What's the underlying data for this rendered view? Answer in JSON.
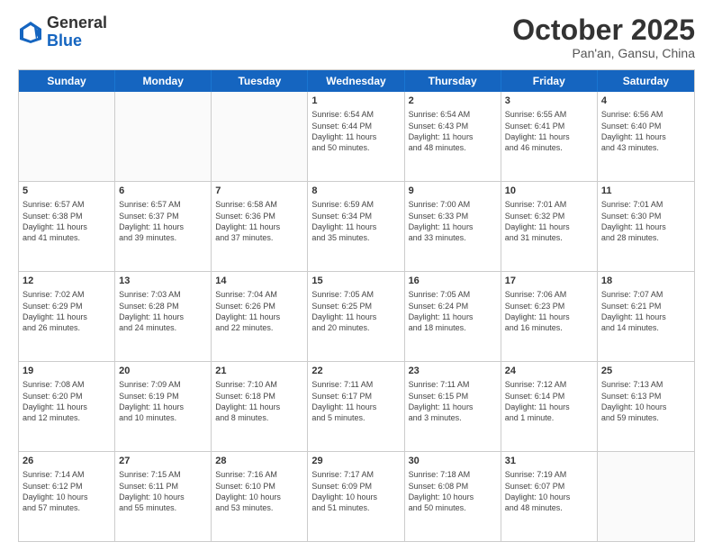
{
  "logo": {
    "general": "General",
    "blue": "Blue"
  },
  "title": "October 2025",
  "subtitle": "Pan'an, Gansu, China",
  "headers": [
    "Sunday",
    "Monday",
    "Tuesday",
    "Wednesday",
    "Thursday",
    "Friday",
    "Saturday"
  ],
  "weeks": [
    [
      {
        "day": "",
        "info": ""
      },
      {
        "day": "",
        "info": ""
      },
      {
        "day": "",
        "info": ""
      },
      {
        "day": "1",
        "info": "Sunrise: 6:54 AM\nSunset: 6:44 PM\nDaylight: 11 hours\nand 50 minutes."
      },
      {
        "day": "2",
        "info": "Sunrise: 6:54 AM\nSunset: 6:43 PM\nDaylight: 11 hours\nand 48 minutes."
      },
      {
        "day": "3",
        "info": "Sunrise: 6:55 AM\nSunset: 6:41 PM\nDaylight: 11 hours\nand 46 minutes."
      },
      {
        "day": "4",
        "info": "Sunrise: 6:56 AM\nSunset: 6:40 PM\nDaylight: 11 hours\nand 43 minutes."
      }
    ],
    [
      {
        "day": "5",
        "info": "Sunrise: 6:57 AM\nSunset: 6:38 PM\nDaylight: 11 hours\nand 41 minutes."
      },
      {
        "day": "6",
        "info": "Sunrise: 6:57 AM\nSunset: 6:37 PM\nDaylight: 11 hours\nand 39 minutes."
      },
      {
        "day": "7",
        "info": "Sunrise: 6:58 AM\nSunset: 6:36 PM\nDaylight: 11 hours\nand 37 minutes."
      },
      {
        "day": "8",
        "info": "Sunrise: 6:59 AM\nSunset: 6:34 PM\nDaylight: 11 hours\nand 35 minutes."
      },
      {
        "day": "9",
        "info": "Sunrise: 7:00 AM\nSunset: 6:33 PM\nDaylight: 11 hours\nand 33 minutes."
      },
      {
        "day": "10",
        "info": "Sunrise: 7:01 AM\nSunset: 6:32 PM\nDaylight: 11 hours\nand 31 minutes."
      },
      {
        "day": "11",
        "info": "Sunrise: 7:01 AM\nSunset: 6:30 PM\nDaylight: 11 hours\nand 28 minutes."
      }
    ],
    [
      {
        "day": "12",
        "info": "Sunrise: 7:02 AM\nSunset: 6:29 PM\nDaylight: 11 hours\nand 26 minutes."
      },
      {
        "day": "13",
        "info": "Sunrise: 7:03 AM\nSunset: 6:28 PM\nDaylight: 11 hours\nand 24 minutes."
      },
      {
        "day": "14",
        "info": "Sunrise: 7:04 AM\nSunset: 6:26 PM\nDaylight: 11 hours\nand 22 minutes."
      },
      {
        "day": "15",
        "info": "Sunrise: 7:05 AM\nSunset: 6:25 PM\nDaylight: 11 hours\nand 20 minutes."
      },
      {
        "day": "16",
        "info": "Sunrise: 7:05 AM\nSunset: 6:24 PM\nDaylight: 11 hours\nand 18 minutes."
      },
      {
        "day": "17",
        "info": "Sunrise: 7:06 AM\nSunset: 6:23 PM\nDaylight: 11 hours\nand 16 minutes."
      },
      {
        "day": "18",
        "info": "Sunrise: 7:07 AM\nSunset: 6:21 PM\nDaylight: 11 hours\nand 14 minutes."
      }
    ],
    [
      {
        "day": "19",
        "info": "Sunrise: 7:08 AM\nSunset: 6:20 PM\nDaylight: 11 hours\nand 12 minutes."
      },
      {
        "day": "20",
        "info": "Sunrise: 7:09 AM\nSunset: 6:19 PM\nDaylight: 11 hours\nand 10 minutes."
      },
      {
        "day": "21",
        "info": "Sunrise: 7:10 AM\nSunset: 6:18 PM\nDaylight: 11 hours\nand 8 minutes."
      },
      {
        "day": "22",
        "info": "Sunrise: 7:11 AM\nSunset: 6:17 PM\nDaylight: 11 hours\nand 5 minutes."
      },
      {
        "day": "23",
        "info": "Sunrise: 7:11 AM\nSunset: 6:15 PM\nDaylight: 11 hours\nand 3 minutes."
      },
      {
        "day": "24",
        "info": "Sunrise: 7:12 AM\nSunset: 6:14 PM\nDaylight: 11 hours\nand 1 minute."
      },
      {
        "day": "25",
        "info": "Sunrise: 7:13 AM\nSunset: 6:13 PM\nDaylight: 10 hours\nand 59 minutes."
      }
    ],
    [
      {
        "day": "26",
        "info": "Sunrise: 7:14 AM\nSunset: 6:12 PM\nDaylight: 10 hours\nand 57 minutes."
      },
      {
        "day": "27",
        "info": "Sunrise: 7:15 AM\nSunset: 6:11 PM\nDaylight: 10 hours\nand 55 minutes."
      },
      {
        "day": "28",
        "info": "Sunrise: 7:16 AM\nSunset: 6:10 PM\nDaylight: 10 hours\nand 53 minutes."
      },
      {
        "day": "29",
        "info": "Sunrise: 7:17 AM\nSunset: 6:09 PM\nDaylight: 10 hours\nand 51 minutes."
      },
      {
        "day": "30",
        "info": "Sunrise: 7:18 AM\nSunset: 6:08 PM\nDaylight: 10 hours\nand 50 minutes."
      },
      {
        "day": "31",
        "info": "Sunrise: 7:19 AM\nSunset: 6:07 PM\nDaylight: 10 hours\nand 48 minutes."
      },
      {
        "day": "",
        "info": ""
      }
    ]
  ]
}
